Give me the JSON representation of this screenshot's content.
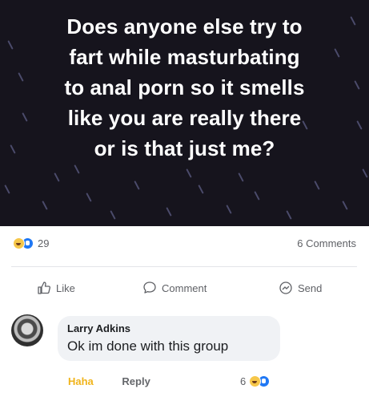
{
  "post": {
    "text_lines": [
      "Does anyone else try to",
      "fart while masturbating",
      "to anal porn so it smells",
      "like you are really there",
      "or is that just me?"
    ],
    "background_color": "#16141d",
    "text_color": "#ffffff"
  },
  "stats": {
    "reactions": [
      "haha",
      "like"
    ],
    "reaction_count": "29",
    "comments_count": "6 Comments"
  },
  "actions": {
    "like_label": "Like",
    "comment_label": "Comment",
    "send_label": "Send"
  },
  "comment": {
    "author": "Larry Adkins",
    "text": "Ok im done with this group",
    "reacted_label": "Haha",
    "reply_label": "Reply",
    "reaction_count": "6",
    "reactions": [
      "haha",
      "like"
    ]
  },
  "colors": {
    "haha": "#f0b41b",
    "like": "#2078f4",
    "muted": "#65676b"
  }
}
